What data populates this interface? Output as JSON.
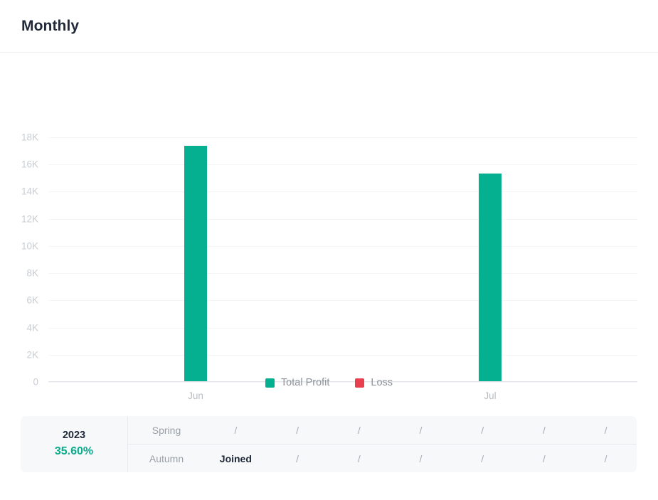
{
  "header": {
    "title": "Monthly"
  },
  "legend": [
    {
      "label": "Total Profit",
      "color": "#04b08f"
    },
    {
      "label": "Loss",
      "color": "#e8404f"
    }
  ],
  "chart_data": {
    "type": "bar",
    "title": "Monthly",
    "categories": [
      "Jun",
      "Jul"
    ],
    "series": [
      {
        "name": "Total Profit",
        "color": "#04b08f",
        "values": [
          17300,
          15300
        ]
      },
      {
        "name": "Loss",
        "color": "#e8404f",
        "values": [
          0,
          0
        ]
      }
    ],
    "xlabel": "",
    "ylabel": "",
    "ylim": [
      0,
      18000
    ],
    "yticks": [
      0,
      2000,
      4000,
      6000,
      8000,
      10000,
      12000,
      14000,
      16000,
      18000
    ],
    "ytick_labels": [
      "0",
      "2K",
      "4K",
      "6K",
      "8K",
      "10K",
      "12K",
      "14K",
      "16K",
      "18K"
    ],
    "grid": true,
    "legend_position": "bottom"
  },
  "table": {
    "year": "2023",
    "percent": "35.60%",
    "rows": [
      {
        "label": "Spring",
        "cells": [
          "/",
          "/",
          "/",
          "/",
          "/",
          "/",
          "/"
        ]
      },
      {
        "label": "Autumn",
        "cells": [
          "Joined",
          "/",
          "/",
          "/",
          "/",
          "/",
          "/"
        ]
      }
    ]
  }
}
